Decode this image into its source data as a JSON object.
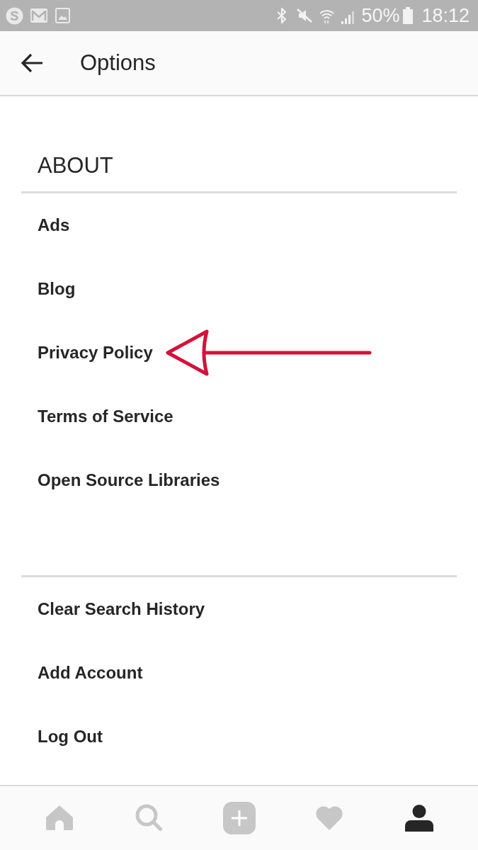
{
  "status_bar": {
    "battery": "50%",
    "time": "18:12"
  },
  "header": {
    "title": "Options"
  },
  "sections": [
    {
      "heading": "ABOUT",
      "items": [
        {
          "label": "Ads",
          "annotated": false
        },
        {
          "label": "Blog",
          "annotated": false
        },
        {
          "label": "Privacy Policy",
          "annotated": true
        },
        {
          "label": "Terms of Service",
          "annotated": false
        },
        {
          "label": "Open Source Libraries",
          "annotated": false
        }
      ]
    },
    {
      "items": [
        {
          "label": "Clear Search History",
          "annotated": false
        },
        {
          "label": "Add Account",
          "annotated": false
        },
        {
          "label": "Log Out",
          "annotated": false
        }
      ]
    }
  ],
  "tab_bar": [
    {
      "kind": "home",
      "selected": false
    },
    {
      "kind": "search",
      "selected": false
    },
    {
      "kind": "add",
      "selected": false
    },
    {
      "kind": "activity",
      "selected": false
    },
    {
      "kind": "profile",
      "selected": true
    }
  ]
}
